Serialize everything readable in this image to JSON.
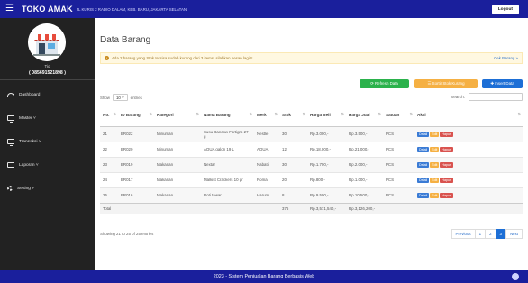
{
  "header": {
    "brand": "TOKO AMAK",
    "address": "JL KURIS 2 RADIO DALAM, KEB. BARU, JAKARTA SELATAN",
    "logout_label": "Logout"
  },
  "sidebar": {
    "user_name": "Tio",
    "user_phone": "( 085691521898 )",
    "items": [
      {
        "label": "Dashboard",
        "icon": "dashboard-icon"
      },
      {
        "label": "Master ˅",
        "icon": "monitor-icon"
      },
      {
        "label": "Transaksi ˅",
        "icon": "monitor-icon"
      },
      {
        "label": "Laporan ˅",
        "icon": "monitor-icon"
      },
      {
        "label": "Setting ˅",
        "icon": "gear-icon"
      }
    ]
  },
  "main": {
    "title": "Data Barang",
    "alert_text": "Ada 2 barang yang Stok tersisa sudah kurang dari 3 items. silahkan pesan lagi !!",
    "alert_link": "Cek Barang »",
    "buttons": {
      "refresh": "⟳ Refresh Data",
      "sort": "☰ Sortir Stok Kurang",
      "insert": "✚ Insert Data"
    },
    "show_label": "Show",
    "show_value": "10",
    "show_suffix": "entries",
    "search_label": "Search:",
    "search_value": "",
    "columns": [
      "No.",
      "ID Barang",
      "Kategori",
      "Nama Barang",
      "Merk",
      "Stok",
      "Harga Beli",
      "Harga Jual",
      "Satuan",
      "Aksi"
    ],
    "rows": [
      {
        "no": "21",
        "id": "BR022",
        "kategori": "Minuman",
        "nama": "Susu Dancow Fortigro 27 g",
        "merk": "Nestle",
        "stok": "30",
        "beli": "Rp.3.000,-",
        "jual": "Rp.3.500,-",
        "satuan": "PCS"
      },
      {
        "no": "22",
        "id": "BR020",
        "kategori": "Minuman",
        "nama": "AQUA galon 19 L",
        "merk": "AQUA",
        "stok": "12",
        "beli": "Rp.18.000,-",
        "jual": "Rp.21.000,-",
        "satuan": "PCS"
      },
      {
        "no": "23",
        "id": "BR019",
        "kategori": "Makanan",
        "nama": "Nextar",
        "merk": "Nabati",
        "stok": "30",
        "beli": "Rp.1.700,-",
        "jual": "Rp.2.000,-",
        "satuan": "PCS"
      },
      {
        "no": "24",
        "id": "BR017",
        "kategori": "Makanan",
        "nama": "Malkist Crackers 10 gr",
        "merk": "Roma",
        "stok": "20",
        "beli": "Rp.800,-",
        "jual": "Rp.1.000,-",
        "satuan": "PCS"
      },
      {
        "no": "25",
        "id": "BR016",
        "kategori": "Makanan",
        "nama": "Roti tawar",
        "merk": "Harum",
        "stok": "8",
        "beli": "Rp.9.500,-",
        "jual": "Rp.10.500,-",
        "satuan": "PCS"
      }
    ],
    "actions": {
      "detail": "Detail",
      "edit": "Edit",
      "hapus": "Hapus"
    },
    "total_label": "Total",
    "total_stok": "376",
    "total_beli": "Rp.3,571,540,-",
    "total_jual": "Rp.3,126,200,-",
    "info": "Showing 21 to 25 of 25 entries",
    "pagination": {
      "previous": "Previous",
      "pages": [
        "1",
        "2",
        "3"
      ],
      "active": "3",
      "next": "Next"
    }
  },
  "footer": {
    "text": "2023 - Sistem Penjualan Barang Berbasis Web"
  },
  "colors": {
    "header_bg": "#1a1f9c",
    "sidebar_bg": "#222222",
    "refresh_btn": "#2bb24c",
    "sort_btn": "#f5b043",
    "insert_btn": "#1d6fd6",
    "hapus_btn": "#d9534f"
  }
}
